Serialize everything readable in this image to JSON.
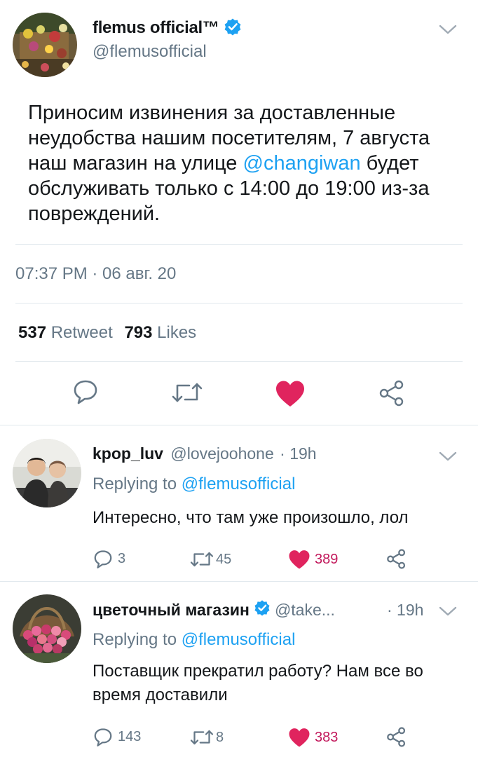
{
  "tweet": {
    "display_name": "flemus official™",
    "handle": "@flemusofficial",
    "text_parts": {
      "before": "Приносим извинения за доставленные неудобства нашим посетителям, 7 августа наш магазин на улице ",
      "mention": "@changiwan",
      "after": " будет обслуживать только с 14:00 до 19:00 из-за повреждений."
    },
    "timestamp": "07:37 PM · 06 авг. 20",
    "retweet_count": "537",
    "retweet_label": "Retweet",
    "likes_count": "793",
    "likes_label": "Likes",
    "liked": true,
    "icons": [
      "reply-icon",
      "retweet-icon",
      "heart-icon",
      "share-icon",
      "chevron-down-icon",
      "verified-icon"
    ]
  },
  "replies": [
    {
      "display_name": "kpop_luv",
      "handle": "@lovejoohone",
      "age": "· 19h",
      "replying_prefix": "Replying to",
      "replying_to": "@flemusofficial",
      "text": "Интересно, что там уже произошло, лол",
      "reply_count": "3",
      "retweet_count": "45",
      "like_count": "389"
    },
    {
      "display_name": "цветочный магазин",
      "handle": "@take...",
      "age": "· 19h",
      "replying_prefix": "Replying to",
      "replying_to": "@flemusofficial",
      "text": "Поставщик прекратил работу? Нам все во время доставили",
      "reply_count": "143",
      "retweet_count": "8",
      "like_count": "383"
    }
  ],
  "colors": {
    "link": "#1da1f2",
    "muted": "#657786",
    "like": "#e0245e",
    "like_count_text": "#c2185b"
  }
}
